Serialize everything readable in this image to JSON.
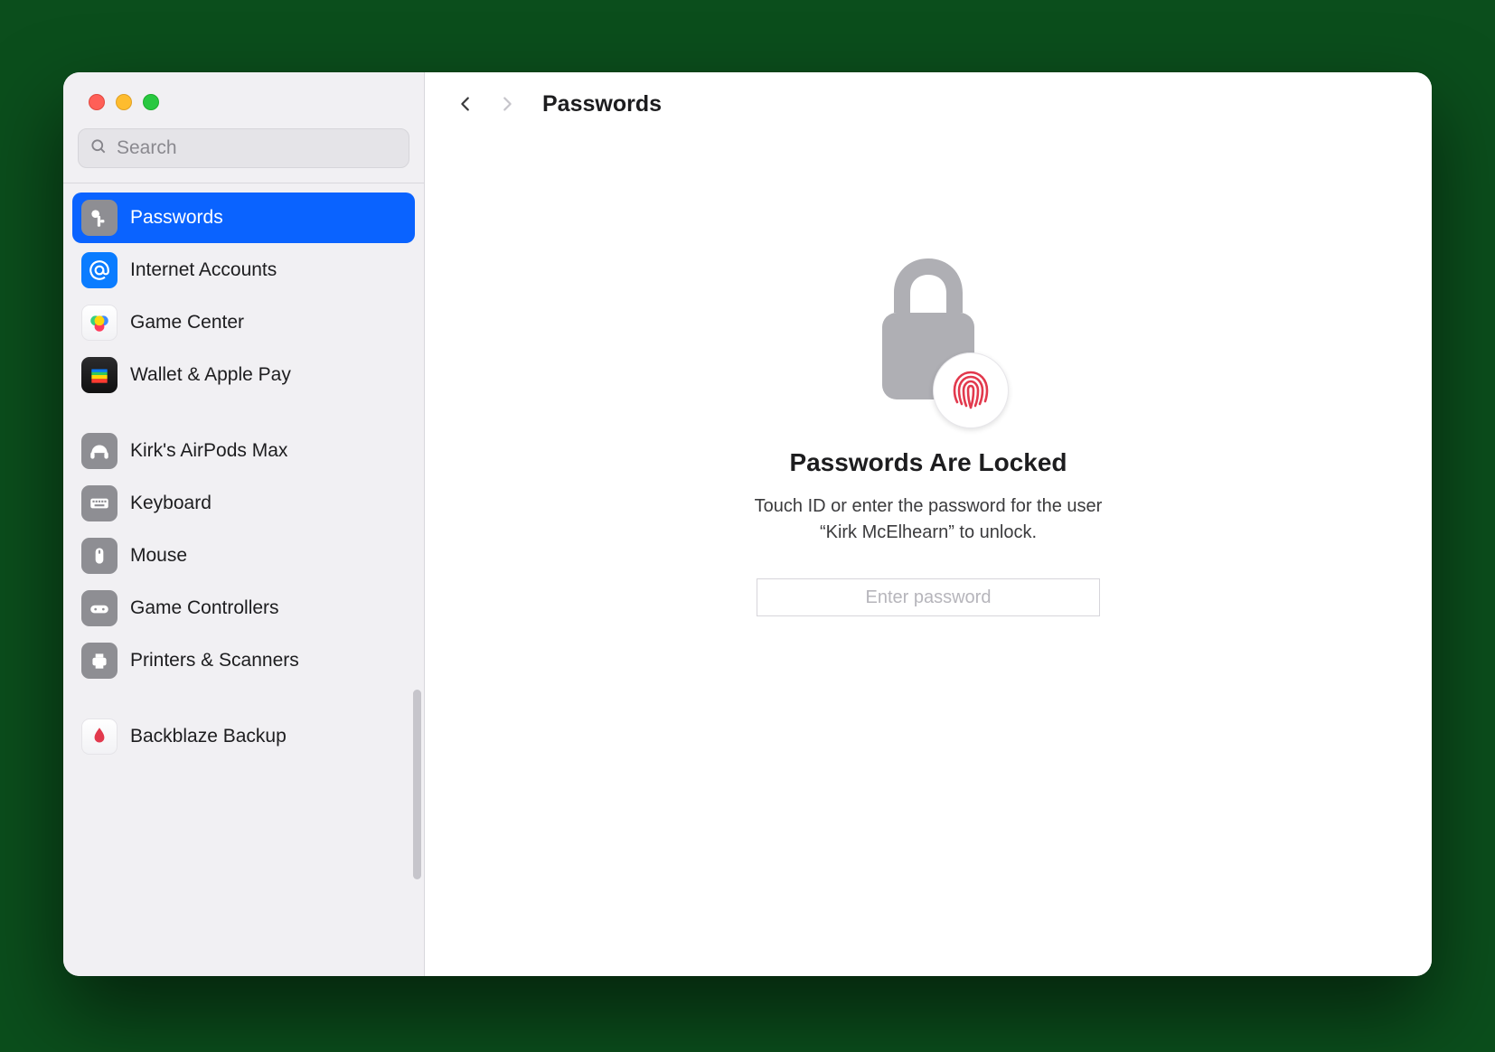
{
  "header": {
    "title": "Passwords"
  },
  "search": {
    "placeholder": "Search",
    "value": ""
  },
  "sidebar": {
    "groups": [
      {
        "items": [
          {
            "icon": "key-icon",
            "label": "Passwords",
            "selected": true
          },
          {
            "icon": "at-icon",
            "label": "Internet Accounts",
            "selected": false
          },
          {
            "icon": "gamecenter-icon",
            "label": "Game Center",
            "selected": false
          },
          {
            "icon": "wallet-icon",
            "label": "Wallet & Apple Pay",
            "selected": false
          }
        ]
      },
      {
        "items": [
          {
            "icon": "headphones-icon",
            "label": "Kirk's AirPods Max",
            "selected": false
          },
          {
            "icon": "keyboard-icon",
            "label": "Keyboard",
            "selected": false
          },
          {
            "icon": "mouse-icon",
            "label": "Mouse",
            "selected": false
          },
          {
            "icon": "gamepad-icon",
            "label": "Game Controllers",
            "selected": false
          },
          {
            "icon": "printer-icon",
            "label": "Printers & Scanners",
            "selected": false
          }
        ]
      },
      {
        "items": [
          {
            "icon": "backblaze-icon",
            "label": "Backblaze Backup",
            "selected": false
          }
        ]
      }
    ]
  },
  "main": {
    "locked_title": "Passwords Are Locked",
    "locked_subtitle_line1": "Touch ID or enter the password for the user",
    "locked_subtitle_line2": "“Kirk McElhearn” to unlock.",
    "password_placeholder": "Enter password",
    "password_value": ""
  },
  "colors": {
    "accent": "#0A63FF",
    "touchid_red": "#E2394D",
    "lock_grey": "#AFAFB4"
  }
}
